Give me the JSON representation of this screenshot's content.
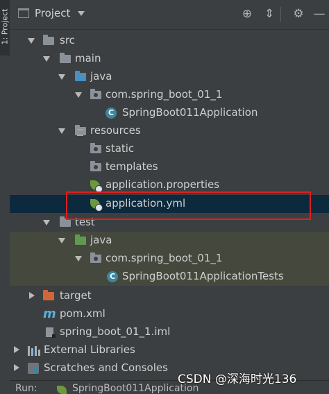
{
  "side_tab": {
    "label": "1: Project"
  },
  "header": {
    "title": "Project"
  },
  "tree": [
    {
      "label": "src"
    },
    {
      "label": "main"
    },
    {
      "label": "java"
    },
    {
      "label": "com.spring_boot_01_1"
    },
    {
      "label": "SpringBoot011Application"
    },
    {
      "label": "resources"
    },
    {
      "label": "static"
    },
    {
      "label": "templates"
    },
    {
      "label": "application.properties"
    },
    {
      "label": "application.yml"
    },
    {
      "label": "test"
    },
    {
      "label": "java"
    },
    {
      "label": "com.spring_boot_01_1"
    },
    {
      "label": "SpringBoot011ApplicationTests"
    },
    {
      "label": "target"
    },
    {
      "label": "pom.xml"
    },
    {
      "label": "spring_boot_01_1.iml"
    },
    {
      "label": "External Libraries"
    },
    {
      "label": "Scratches and Consoles"
    }
  ],
  "bottom": {
    "run_label": "Run:",
    "run_target": "SpringBoot011Application"
  },
  "watermark": "CSDN @深海时光136",
  "colors": {
    "selection": "#0d293e",
    "highlight_box": "#e21d1d",
    "test_tint": "#45493d"
  }
}
